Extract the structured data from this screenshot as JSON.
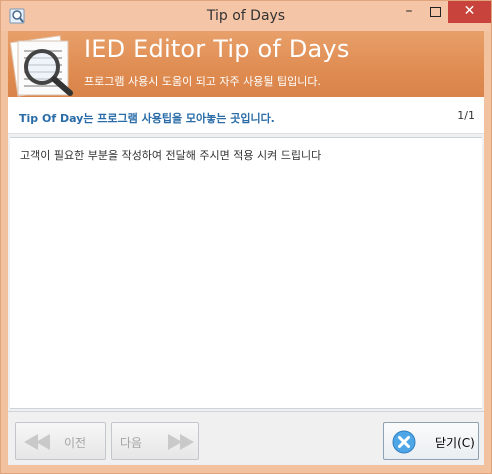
{
  "window": {
    "title": "Tip of Days"
  },
  "banner": {
    "title": "IED Editor Tip of Days",
    "subtitle": "프로그램 사용시 도움이 되고 자주 사용될 팁입니다."
  },
  "tip": {
    "heading": "Tip Of Day는 프로그램 사용팁을 모아놓는 곳입니다.",
    "page": "1/1",
    "content": "고객이 필요한 부분을 작성하여 전달해 주시면 적용 시켜 드립니다"
  },
  "buttons": {
    "prev_label": "이전",
    "next_label": "다음",
    "close_label": "닫기(C)"
  },
  "colors": {
    "banner": "#df8c51",
    "heading_text": "#2a6ca8",
    "close_button": "#c7433b"
  }
}
